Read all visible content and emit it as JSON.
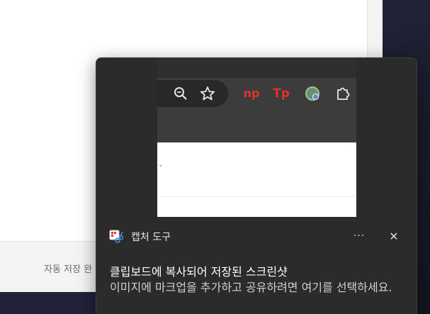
{
  "background_app": {
    "autosave_text": "자동 저장 완"
  },
  "toast": {
    "app_name": "캡처 도구",
    "title": "클립보드에 복사되어 저장된 스크린샷",
    "body": "이미지에 마크업을 추가하고 공유하려면 여기를 선택하세요.",
    "more_label": "···",
    "close_label": "✕",
    "preview": {
      "extensions": {
        "np_label": "np",
        "tp_label": "Tp"
      },
      "icons": [
        "zoom-icon",
        "bookmark-star-icon",
        "np-extension-icon",
        "tp-extension-icon",
        "green-extension-icon",
        "puzzle-extensions-icon"
      ]
    }
  },
  "colors": {
    "toast_bg": "#2b2b2b",
    "extension_red": "#e2322b",
    "desktop_bg": "#1b1d2e"
  }
}
